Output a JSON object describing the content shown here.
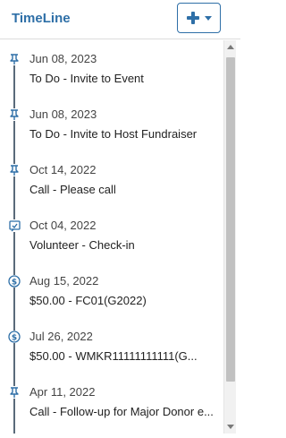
{
  "header": {
    "title": "TimeLine",
    "add_button": {
      "icon": "plus-icon",
      "dropdown_icon": "caret-down-icon"
    }
  },
  "colors": {
    "accent": "#2e6fa7",
    "line": "#5a6a7a"
  },
  "timeline": {
    "items": [
      {
        "icon": "pin-icon",
        "date": "Jun 08, 2023",
        "description": "To Do - Invite to Event"
      },
      {
        "icon": "pin-icon",
        "date": "Jun 08, 2023",
        "description": "To Do - Invite to Host Fundraiser"
      },
      {
        "icon": "pin-icon",
        "date": "Oct 14, 2022",
        "description": "Call - Please call"
      },
      {
        "icon": "checkin-icon",
        "date": "Oct 04, 2022",
        "description": "Volunteer - Check-in"
      },
      {
        "icon": "dollar-icon",
        "date": "Aug 15, 2022",
        "description": "$50.00 - FC01(G2022)"
      },
      {
        "icon": "dollar-icon",
        "date": "Jul 26, 2022",
        "description": "$50.00 - WMKR11111111111(G..."
      },
      {
        "icon": "pin-icon",
        "date": "Apr 11, 2022",
        "description": "Call - Follow-up for Major Donor e..."
      }
    ]
  }
}
